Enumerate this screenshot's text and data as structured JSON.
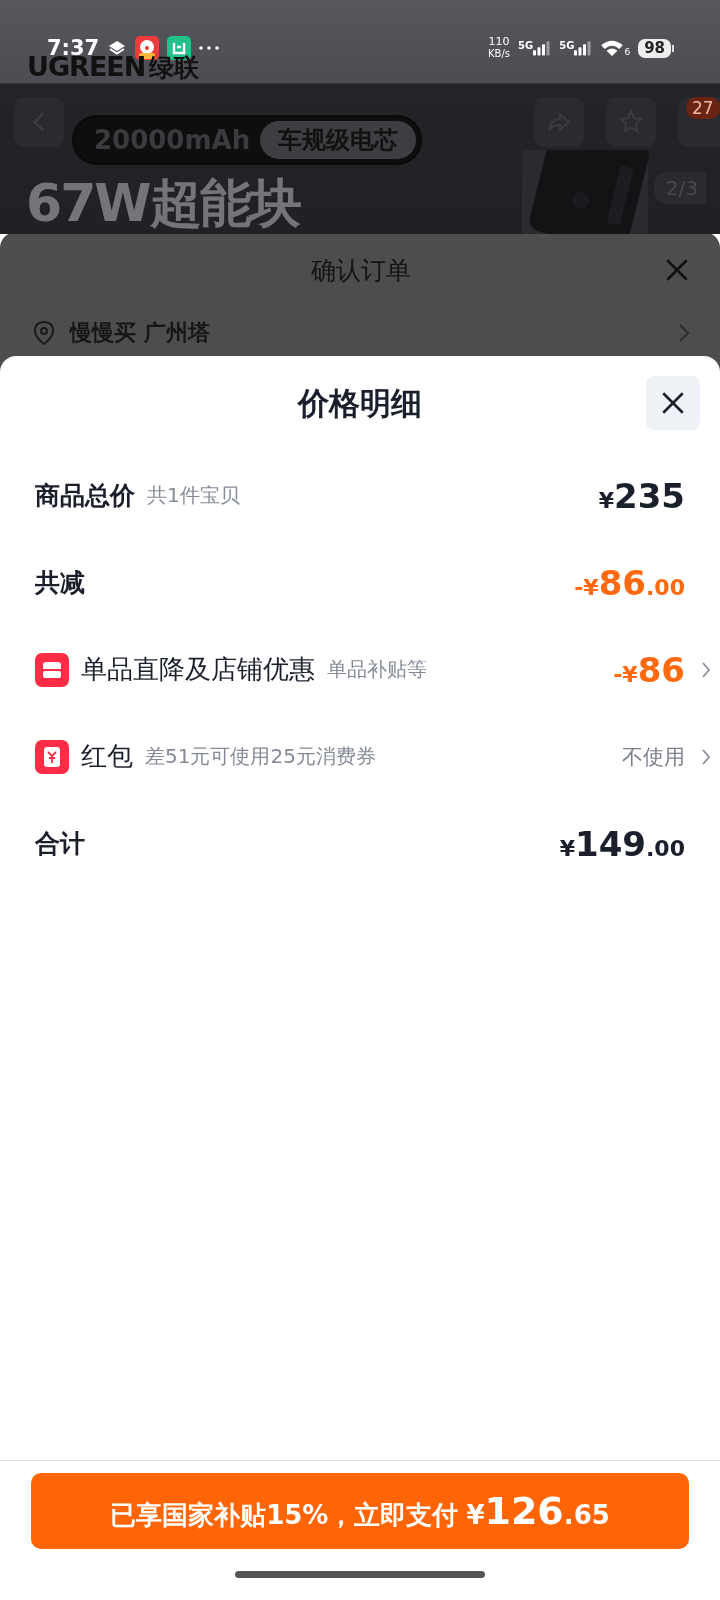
{
  "status_bar": {
    "time": "7:37",
    "net_speed": "110",
    "net_unit": "KB/s",
    "sim_1": "5G",
    "sim_2": "5G",
    "wifi_number": "6",
    "battery": "98"
  },
  "product_page": {
    "brand": "UGREEN",
    "brand_cn": "绿联",
    "tags": [
      "20000mAh",
      "车规级电芯"
    ],
    "headline": "67W超能块",
    "cart_count": "27",
    "image_counter": "2/3"
  },
  "order_sheet": {
    "title": "确认订单",
    "address": "慢慢买 广州塔"
  },
  "price_detail": {
    "title": "价格明细",
    "rows": [
      {
        "kind": "subtotal",
        "label": "商品总价",
        "note": "共1件宝贝",
        "amount": {
          "prefix": "¥",
          "main": "235"
        },
        "has_detail": false
      },
      {
        "kind": "deduction",
        "label": "共减",
        "amount": {
          "prefix": "-¥",
          "main": "86",
          "fraction": ".00"
        },
        "has_detail": false
      },
      {
        "kind": "promotion",
        "label": "单品直降及店铺优惠",
        "note": "单品补贴等",
        "amount": {
          "prefix": "-¥",
          "main": "86"
        },
        "has_detail": true
      },
      {
        "kind": "coupon",
        "label": "红包",
        "note": "差51元可使用25元消费券",
        "status": "不使用",
        "has_detail": true
      },
      {
        "kind": "total",
        "label": "合计",
        "amount": {
          "prefix": "¥",
          "main": "149",
          "fraction": ".00"
        },
        "has_detail": false
      }
    ],
    "pay_button": {
      "label": "已享国家补贴15%，立即支付",
      "currency": "¥",
      "main": "126",
      "fraction": ".65"
    }
  }
}
